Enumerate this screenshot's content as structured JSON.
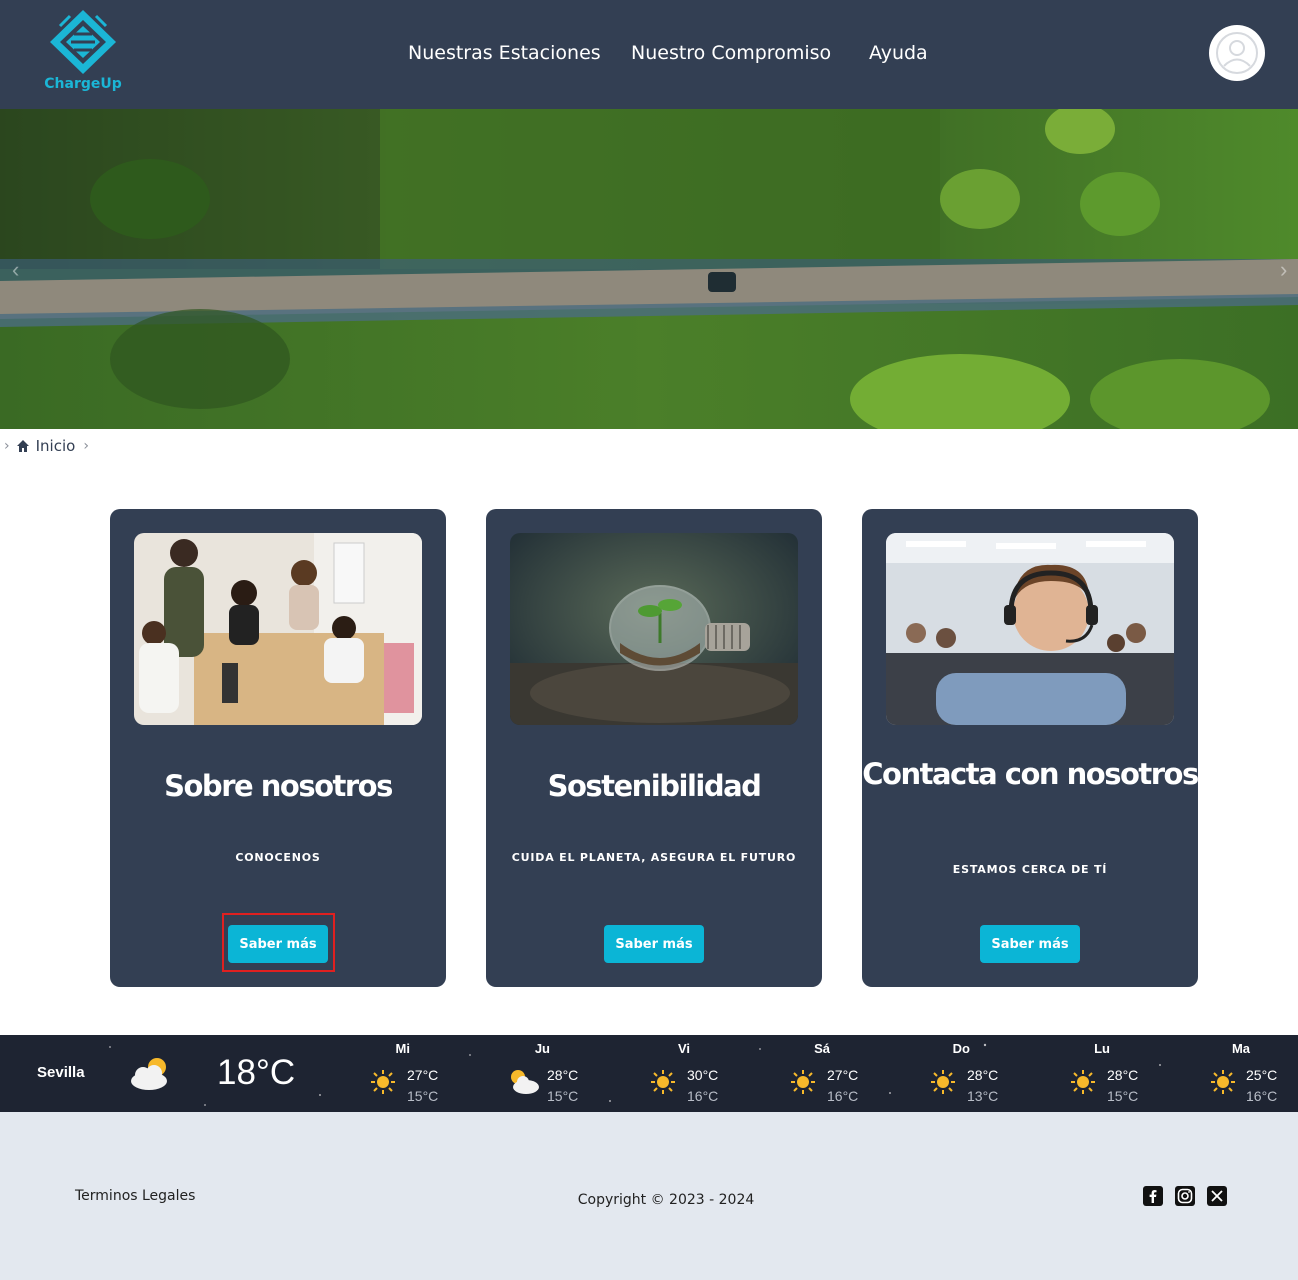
{
  "brand": {
    "name": "ChargeUp",
    "accent": "#1bb6d6"
  },
  "nav": {
    "items": [
      {
        "label": "Nuestras Estaciones"
      },
      {
        "label": "Nuestro Compromiso"
      },
      {
        "label": "Ayuda"
      }
    ]
  },
  "breadcrumb": {
    "home_label": "Inicio"
  },
  "cards": [
    {
      "title": "Sobre nosotros",
      "subtitle": "CONOCENOS",
      "button": "Saber más"
    },
    {
      "title": "Sostenibilidad",
      "subtitle": "CUIDA EL PLANETA, ASEGURA EL FUTURO",
      "button": "Saber más"
    },
    {
      "title": "Contacta con nosotros",
      "subtitle": "ESTAMOS CERCA DE TÍ",
      "button": "Saber más"
    }
  ],
  "weather": {
    "city": "Sevilla",
    "current_temp": "18°C",
    "current_icon": "partly-cloudy-icon",
    "days": [
      {
        "day": "Mi",
        "hi": "27°C",
        "lo": "15°C",
        "icon": "sun-icon"
      },
      {
        "day": "Ju",
        "hi": "28°C",
        "lo": "15°C",
        "icon": "partly-cloudy-icon"
      },
      {
        "day": "Vi",
        "hi": "30°C",
        "lo": "16°C",
        "icon": "sun-icon"
      },
      {
        "day": "Sá",
        "hi": "27°C",
        "lo": "16°C",
        "icon": "sun-icon"
      },
      {
        "day": "Do",
        "hi": "28°C",
        "lo": "13°C",
        "icon": "sun-icon"
      },
      {
        "day": "Lu",
        "hi": "28°C",
        "lo": "15°C",
        "icon": "sun-icon"
      },
      {
        "day": "Ma",
        "hi": "25°C",
        "lo": "16°C",
        "icon": "sun-icon"
      }
    ]
  },
  "footer": {
    "legal": "Terminos Legales",
    "copyright": "Copyright © 2023 - 2024",
    "social": [
      "facebook-icon",
      "instagram-icon",
      "x-icon"
    ]
  },
  "colors": {
    "header_bg": "#333f53",
    "card_bg": "#333f53",
    "button_bg": "#0bb5d6",
    "footer_bg": "#e3e8ef",
    "weather_bg": "#1e2432"
  }
}
